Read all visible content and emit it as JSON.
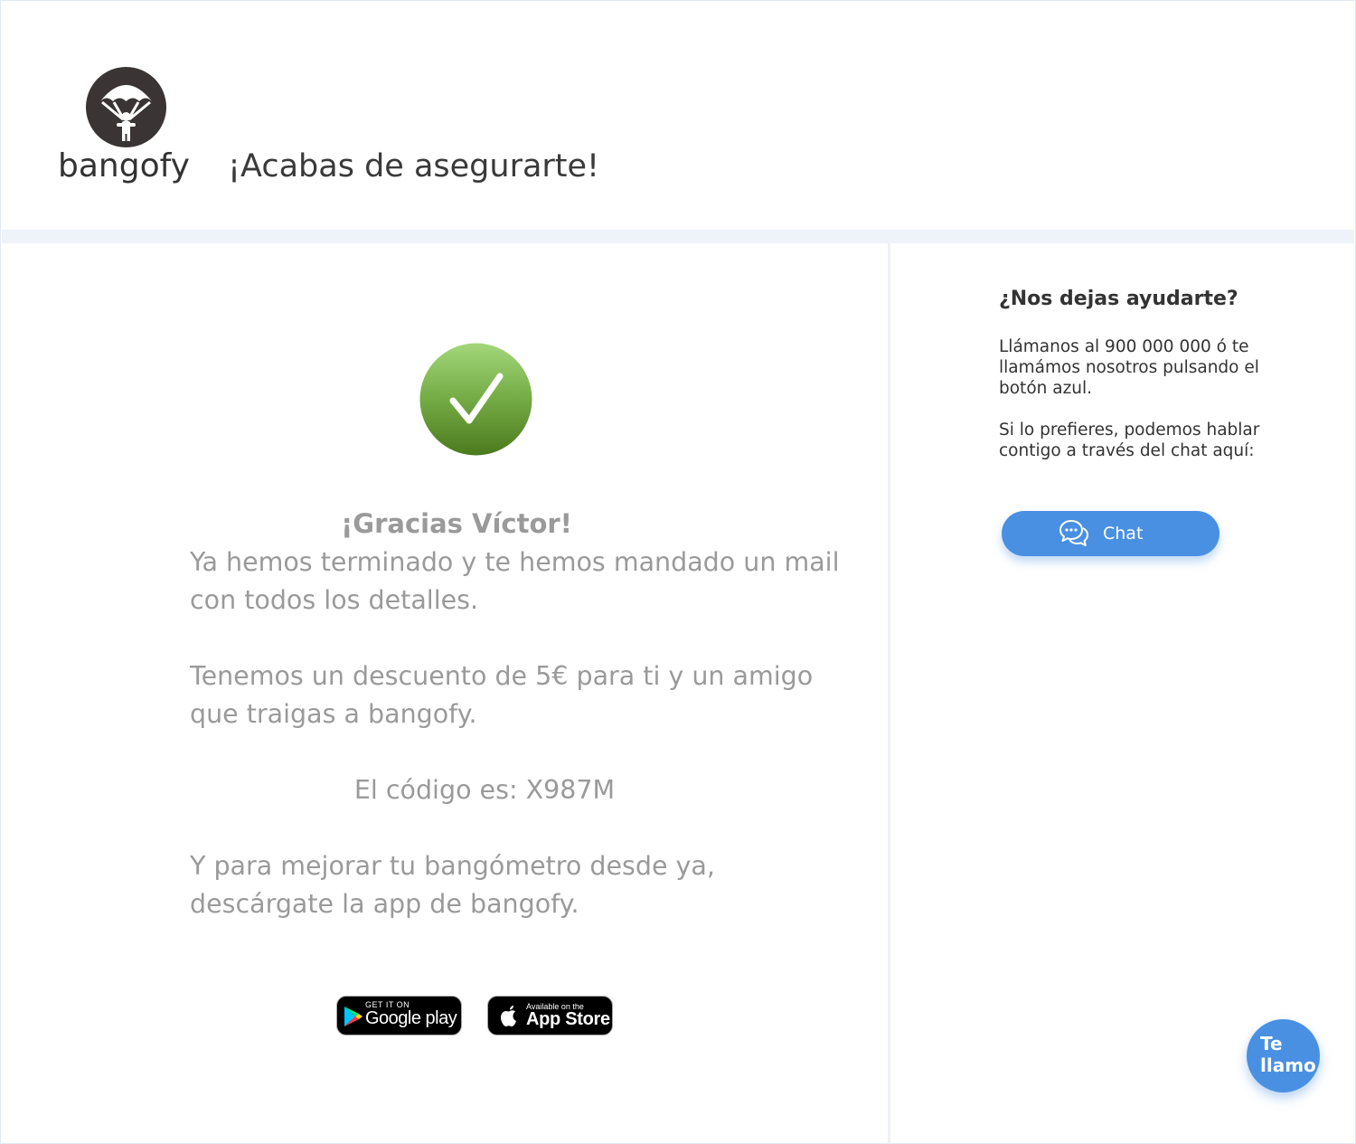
{
  "header": {
    "logo_text": "bangofy",
    "logo_icon": "parachute-icon",
    "title": "¡Acabas de asegurarte!"
  },
  "main": {
    "success_icon": "checkmark-icon",
    "thanks": "¡Gracias Víctor!",
    "message1": "Ya hemos terminado y te hemos mandado un mail con todos los detalles.",
    "message2": "Tenemos un descuento de 5€ para ti y un amigo que traigas a bangofy.",
    "code_line": "El código es: X987M",
    "message3": "Y para mejorar tu bangómetro desde ya, descárgate la app de bangofy.",
    "google_play": {
      "small": "GET IT ON",
      "big": "Google play"
    },
    "app_store": {
      "small": "Available on the",
      "big": "App Store"
    }
  },
  "sidebar": {
    "title": "¿Nos dejas ayudarte?",
    "text1": "Llámanos al 900 000 000 ó te llamámos nosotros pulsando el botón azul.",
    "text2": "Si lo prefieres, podemos hablar contigo a través del chat aquí:",
    "chat_label": "Chat",
    "chat_icon": "chat-bubbles-icon"
  },
  "call_button": {
    "line1": "Te",
    "line2": "llamo"
  },
  "colors": {
    "accent": "#4a90e2",
    "success": "#5e9a2e",
    "text_muted": "#9a9a9a",
    "text_dark": "#333333",
    "divider": "#eef3f9"
  }
}
